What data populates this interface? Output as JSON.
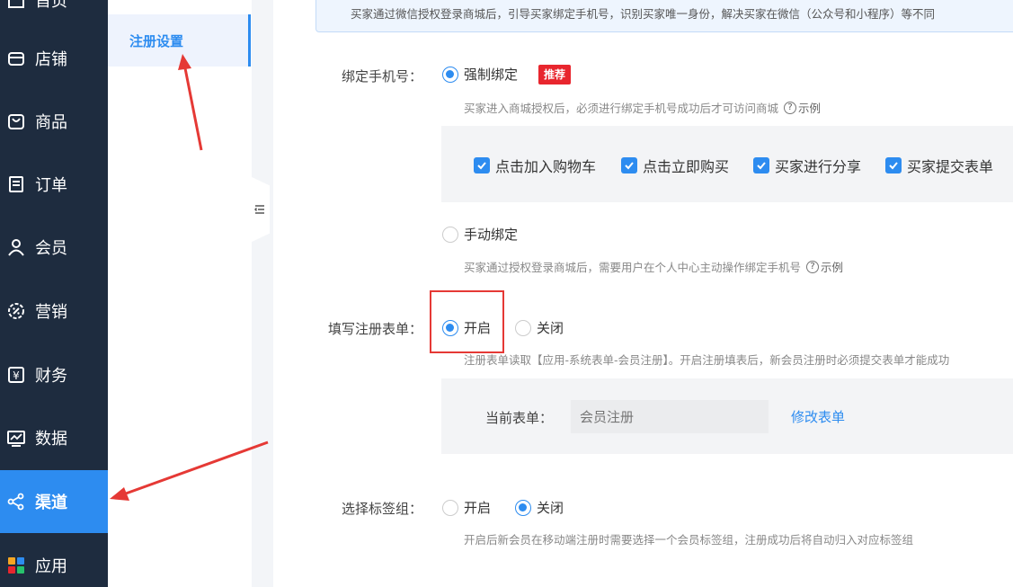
{
  "nav": {
    "items": [
      {
        "label": "首页",
        "icon": "home-icon"
      },
      {
        "label": "店铺",
        "icon": "store-icon"
      },
      {
        "label": "商品",
        "icon": "bag-icon"
      },
      {
        "label": "订单",
        "icon": "order-icon"
      },
      {
        "label": "会员",
        "icon": "user-icon"
      },
      {
        "label": "营销",
        "icon": "gear-badge-icon"
      },
      {
        "label": "财务",
        "icon": "yen-icon"
      },
      {
        "label": "数据",
        "icon": "chart-icon"
      },
      {
        "label": "渠道",
        "icon": "share-icon",
        "active": true
      },
      {
        "label": "应用",
        "icon": "apps-icon"
      }
    ]
  },
  "subnav": {
    "active_label": "注册设置"
  },
  "notice": {
    "text": "买家通过微信授权登录商城后，引导买家绑定手机号，识别买家唯一身份，解决买家在微信（公众号和小程序）等不同"
  },
  "bind_phone": {
    "label": "绑定手机号：",
    "forced": {
      "label": "强制绑定",
      "selected": true,
      "badge": "推荐"
    },
    "forced_hint": "买家进入商城授权后，必须进行绑定手机号成功后才可访问商城",
    "example_label": "示例",
    "triggers": [
      "点击加入购物车",
      "点击立即购买",
      "买家进行分享",
      "买家提交表单"
    ],
    "manual": {
      "label": "手动绑定",
      "selected": false
    },
    "manual_hint": "买家通过授权登录商城后，需要用户在个人中心主动操作绑定手机号"
  },
  "register_form": {
    "label": "填写注册表单：",
    "on_label": "开启",
    "off_label": "关闭",
    "selected": "开启",
    "hint": "注册表单读取【应用-系统表单-会员注册】。开启注册填表后，新会员注册时必须提交表单才能成功",
    "current_form_label": "当前表单：",
    "current_form_placeholder": "会员注册",
    "modify_link": "修改表单"
  },
  "tag_group": {
    "label": "选择标签组：",
    "on_label": "开启",
    "off_label": "关闭",
    "selected": "关闭",
    "hint": "开启后新会员在移动端注册时需要选择一个会员标签组，注册成功后将自动归入对应标签组"
  },
  "colors": {
    "nav_bg": "#1e2c3f",
    "accent": "#2d8cf0",
    "badge": "#e8262e",
    "annotation": "#e53935"
  }
}
